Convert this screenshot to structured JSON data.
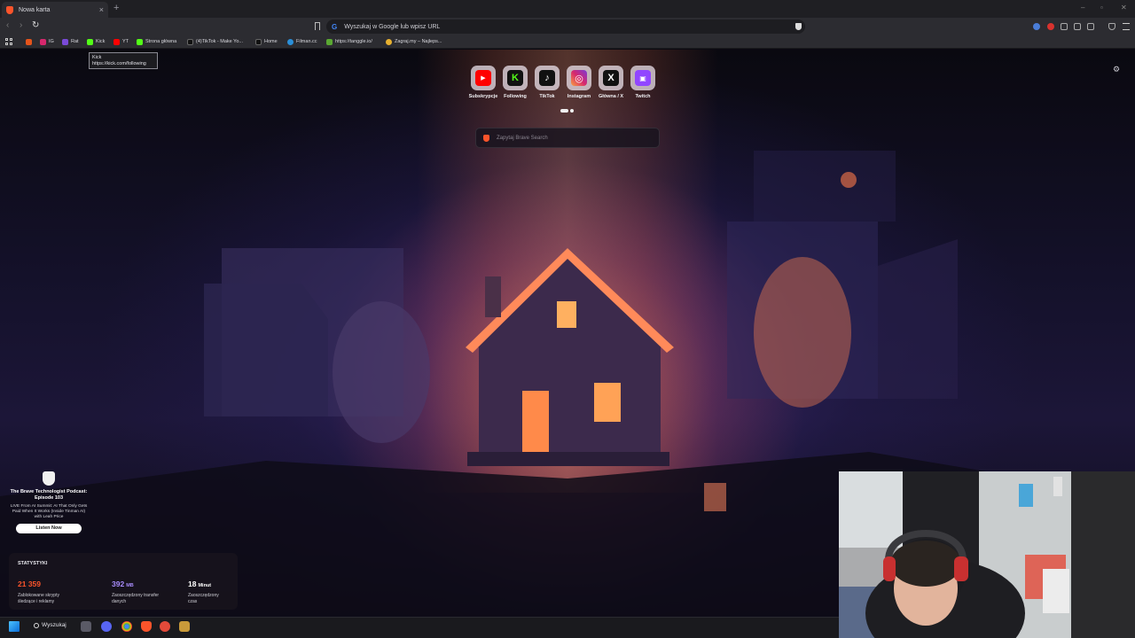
{
  "tab": {
    "title": "Nowa karta",
    "close": "×",
    "new": "+"
  },
  "window_controls": {
    "minimize": "–",
    "maximize": "▫",
    "close": "✕"
  },
  "toolbar": {
    "back": "‹",
    "forward": "›",
    "reload": "↻"
  },
  "omnibox": {
    "g": "G",
    "text": "Wyszukaj w Google lub wpisz URL"
  },
  "bookmarks": [
    {
      "label": "IG"
    },
    {
      "label": "Rat"
    },
    {
      "label": "Kick"
    },
    {
      "label": "YT"
    },
    {
      "label": "Strona główna"
    },
    {
      "label": "(4)TikTok - Make Yo..."
    },
    {
      "label": "Home"
    },
    {
      "label": "Filman.cc"
    },
    {
      "label": "https://tanggle.io/"
    },
    {
      "label": "Zagraj.my – Najleps..."
    }
  ],
  "tooltip": {
    "title": "Kick",
    "url": "https://kick.com/following"
  },
  "top_sites": [
    {
      "name": "Subskrypcje",
      "glyph": "▶"
    },
    {
      "name": "Following",
      "glyph": "K"
    },
    {
      "name": "TikTok",
      "glyph": "♪"
    },
    {
      "name": "Instagram",
      "glyph": "◎"
    },
    {
      "name": "Główna / X",
      "glyph": "X"
    },
    {
      "name": "Twitch",
      "glyph": "▣"
    }
  ],
  "search": {
    "placeholder": "Zapytaj Brave Search"
  },
  "settings_icon": "⚙",
  "podcast": {
    "title": "The Brave Technologist Podcast: Episode 103",
    "description": "LIVE From AI Summit: AI That Only Gets Paid When It Works (Inside Tinman AI) with Leah Price",
    "button": "Listen Now"
  },
  "stats": {
    "heading": "STATYSTYKI",
    "items": [
      {
        "value": "21 359",
        "unit": "",
        "label": "Zablokowane skrypty śledzące i reklamy",
        "color": "#fb542b"
      },
      {
        "value": "392",
        "unit": "MB",
        "label": "Zaoszczędzony transfer danych",
        "color": "#a78bfa"
      },
      {
        "value": "18",
        "unit": "Minut",
        "label": "Zaoszczędzony czas",
        "color": "#ffffff"
      }
    ]
  },
  "taskbar": {
    "search_label": "Wyszukaj"
  }
}
